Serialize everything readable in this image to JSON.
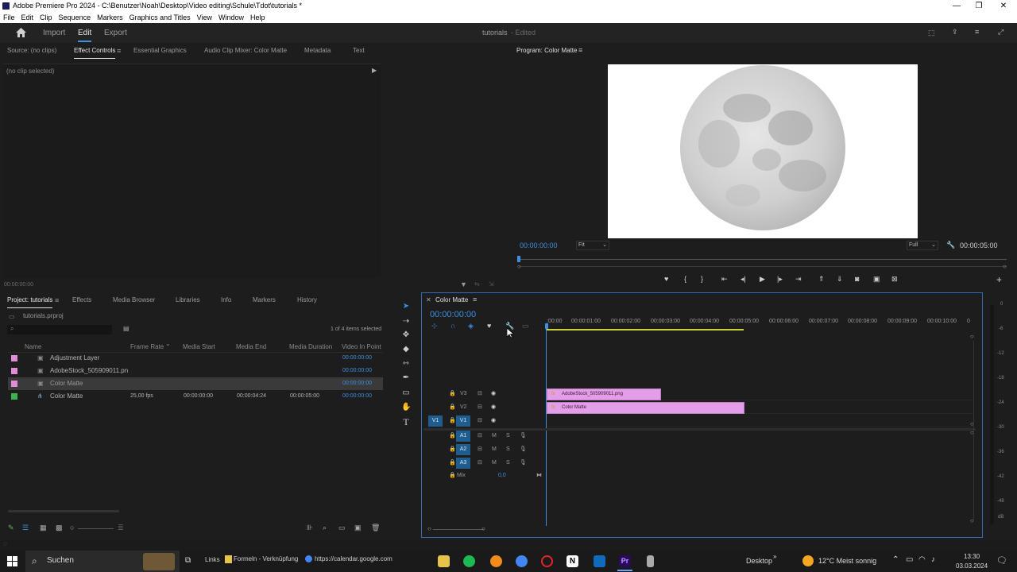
{
  "window": {
    "title": "Adobe Premiere Pro 2024 - C:\\Benutzer\\Noah\\Desktop\\Video editing\\Schule\\Tdot\\tutorials *"
  },
  "menu": [
    "File",
    "Edit",
    "Clip",
    "Sequence",
    "Markers",
    "Graphics and Titles",
    "View",
    "Window",
    "Help"
  ],
  "appbar": {
    "import": "Import",
    "edit": "Edit",
    "export": "Export",
    "project_name": "tutorials",
    "edited": "- Edited"
  },
  "source_panel": {
    "tabs": [
      "Source: (no clips)",
      "Effect Controls",
      "Essential Graphics",
      "Audio Clip Mixer: Color Matte",
      "Metadata",
      "Text"
    ],
    "no_clip": "(no clip selected)",
    "timecode": "00:00:00:00"
  },
  "program_monitor": {
    "title": "Program: Color Matte",
    "timecode": "00:00:00:00",
    "fit": "Fit",
    "quality": "Full",
    "duration": "00:00:05:00"
  },
  "project_panel": {
    "tabs": [
      "Project: tutorials",
      "Effects",
      "Media Browser",
      "Libraries",
      "Info",
      "Markers",
      "History"
    ],
    "file": "tutorials.prproj",
    "selection": "1 of 4 items selected",
    "columns": [
      "Name",
      "Frame Rate",
      "Media Start",
      "Media End",
      "Media Duration",
      "Video In Point"
    ],
    "items": [
      {
        "name": "Adjustment Layer",
        "frame_rate": "",
        "start": "",
        "end": "",
        "duration": "",
        "in_point": "00:00:00:00",
        "color": "#e38ad8"
      },
      {
        "name": "AdobeStock_505909011.pn",
        "frame_rate": "",
        "start": "",
        "end": "",
        "duration": "",
        "in_point": "00:00:00:00",
        "color": "#e38ad8"
      },
      {
        "name": "Color Matte",
        "frame_rate": "",
        "start": "",
        "end": "",
        "duration": "",
        "in_point": "00:00:00:00",
        "color": "#e38ad8"
      },
      {
        "name": "Color Matte",
        "frame_rate": "25,00 fps",
        "start": "00:00:00:00",
        "end": "00:00:04:24",
        "duration": "00:00:05:00",
        "in_point": "00:00:00:00",
        "color": "#3cb44b"
      }
    ]
  },
  "timeline": {
    "title": "Color Matte",
    "timecode": "00:00:00:00",
    "ruler": [
      ":00:00",
      "00:00:01:00",
      "00:00:02:00",
      "00:00:03:00",
      "00:00:04:00",
      "00:00:05:00",
      "00:00:06:00",
      "00:00:07:00",
      "00:00:08:00",
      "00:00:09:00",
      "00:00:10:00",
      "0"
    ],
    "video_tracks": [
      "V3",
      "V2",
      "V1"
    ],
    "audio_tracks": [
      "A1",
      "A2",
      "A3"
    ],
    "source_patch_v": "V1",
    "mix_label": "Mix",
    "mix_value": "0,0",
    "mute": "M",
    "solo": "S",
    "clips": [
      {
        "name": "AdobeStock_505909011.png",
        "track": "V3",
        "start": 0,
        "end": 2.9
      },
      {
        "name": "Color Matte",
        "track": "V2",
        "start": 0,
        "end": 5
      }
    ],
    "meter_labels": [
      "0",
      "-6",
      "-12",
      "-18",
      "-24",
      "-30",
      "-36",
      "-42",
      "-48",
      "dB"
    ]
  },
  "taskbar": {
    "search": "Suchen",
    "links": "Links",
    "formeln": "Formeln - Verknüpfung",
    "calendar": "https://calendar.google.com",
    "desktop": "Desktop",
    "weather": "12°C  Meist sonnig",
    "time": "13:30",
    "date": "03.03.2024"
  }
}
